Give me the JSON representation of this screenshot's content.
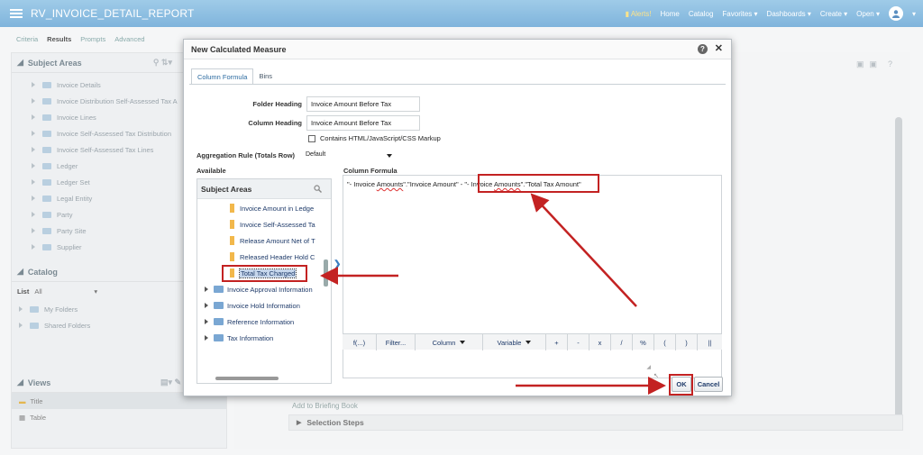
{
  "app": {
    "title": "RV_INVOICE_DETAIL_REPORT",
    "nav": {
      "alerts": "Alerts!",
      "home": "Home",
      "catalog": "Catalog",
      "favorites": "Favorites ▾",
      "dashboards": "Dashboards ▾",
      "create": "Create ▾",
      "open": "Open ▾"
    }
  },
  "page_tabs": [
    "Criteria",
    "Results",
    "Prompts",
    "Advanced"
  ],
  "subject_areas": {
    "title": "Subject Areas",
    "items": [
      "Invoice Details",
      "Invoice Distribution Self-Assessed Tax A",
      "Invoice Lines",
      "Invoice Self-Assessed Tax Distribution",
      "Invoice Self-Assessed Tax Lines",
      "Ledger",
      "Ledger Set",
      "Legal Entity",
      "Party",
      "Party Site",
      "Supplier"
    ]
  },
  "catalog": {
    "title": "Catalog",
    "list_label": "List",
    "list_value": "All",
    "folders": [
      "My Folders",
      "Shared Folders"
    ]
  },
  "views": {
    "title": "Views",
    "items": [
      "Title",
      "Table"
    ]
  },
  "main": {
    "briefing": "Add to Briefing Book",
    "selection_steps": "Selection Steps"
  },
  "dialog": {
    "title": "New Calculated Measure",
    "help": "?",
    "tabs": [
      "Column Formula",
      "Bins"
    ],
    "folder_heading_label": "Folder Heading",
    "folder_heading_value": "Invoice Amount Before Tax",
    "column_heading_label": "Column Heading",
    "column_heading_value": "Invoice Amount Before Tax",
    "checkbox_label": "Contains HTML/JavaScript/CSS Markup",
    "aggregation_label": "Aggregation Rule (Totals Row)",
    "aggregation_value": "Default",
    "available_label": "Available",
    "column_formula_label": "Column Formula",
    "available_panel_title": "Subject Areas",
    "columns": [
      "Invoice Amount in Ledge",
      "Invoice Self-Assessed Ta",
      "Release Amount Net of T",
      "Released Header Hold C",
      "Total Tax Charged"
    ],
    "folders": [
      "Invoice Approval Information",
      "Invoice Hold Information",
      "Reference Information",
      "Tax Information"
    ],
    "formula": {
      "p1": "\"- Invoice ",
      "p2": "Amounts",
      "p3": "\".\"Invoice Amount\" - \"- ",
      "p4": "Invoice ",
      "p5": "Amounts",
      "p6": "\".\"Total Tax Amount\""
    },
    "toolbar": [
      "f(...)",
      "Filter...",
      "Column",
      "Variable",
      "+",
      "-",
      "x",
      "/",
      "%",
      "(",
      ")",
      "||"
    ],
    "ok": "OK",
    "cancel": "Cancel"
  },
  "colors": {
    "topbar": "#8bbde2",
    "annotation": "#c32222",
    "link": "#1f3b6a"
  }
}
